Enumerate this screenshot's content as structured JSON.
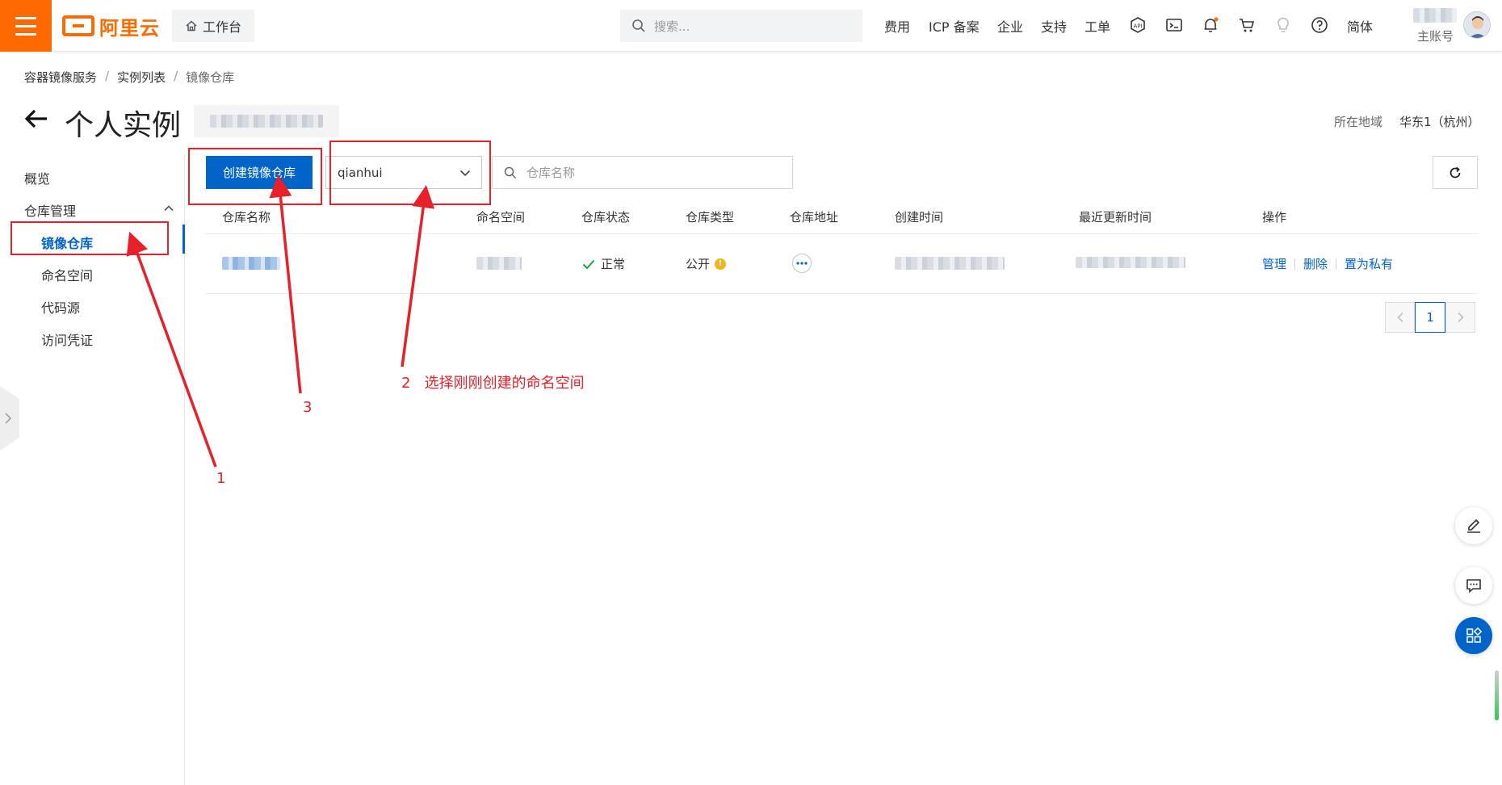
{
  "topbar": {
    "logo_text": "阿里云",
    "workbench_label": "工作台",
    "search_placeholder": "搜索...",
    "nav": {
      "fees": "费用",
      "icp": "ICP 备案",
      "enterprise": "企业",
      "support": "支持",
      "ticket": "工单",
      "language": "简体"
    },
    "icons": [
      "app-icon",
      "terminal-icon",
      "bell-icon",
      "cart-icon",
      "bulb-icon",
      "help-icon"
    ],
    "account_sub": "主账号"
  },
  "breadcrumb": [
    "容器镜像服务",
    "实例列表",
    "镜像仓库"
  ],
  "breadcrumb_sep": "/",
  "page": {
    "title": "个人实例",
    "region_label": "所在地域",
    "region_value": "华东1（杭州）"
  },
  "sidebar": {
    "overview": "概览",
    "repo_mgmt": "仓库管理",
    "items": [
      "镜像仓库",
      "命名空间",
      "代码源",
      "访问凭证"
    ]
  },
  "toolbar": {
    "create_label": "创建镜像仓库",
    "namespace_value": "qianhui",
    "search_placeholder": "仓库名称"
  },
  "table": {
    "headers": [
      "仓库名称",
      "命名空间",
      "仓库状态",
      "仓库类型",
      "仓库地址",
      "创建时间",
      "最近更新时间",
      "操作"
    ],
    "row": {
      "status": "正常",
      "type": "公开",
      "actions": [
        "管理",
        "删除",
        "置为私有"
      ]
    }
  },
  "pagination": {
    "current": "1"
  },
  "annotations": {
    "label_1": "1",
    "label_2": "2   选择刚刚创建的命名空间",
    "label_3": "3"
  },
  "colors": {
    "brand": "#ff6a00",
    "primary": "#0064c8",
    "annotation": "#e8202a",
    "success": "#1aa34a",
    "warning": "#f5b21b"
  }
}
